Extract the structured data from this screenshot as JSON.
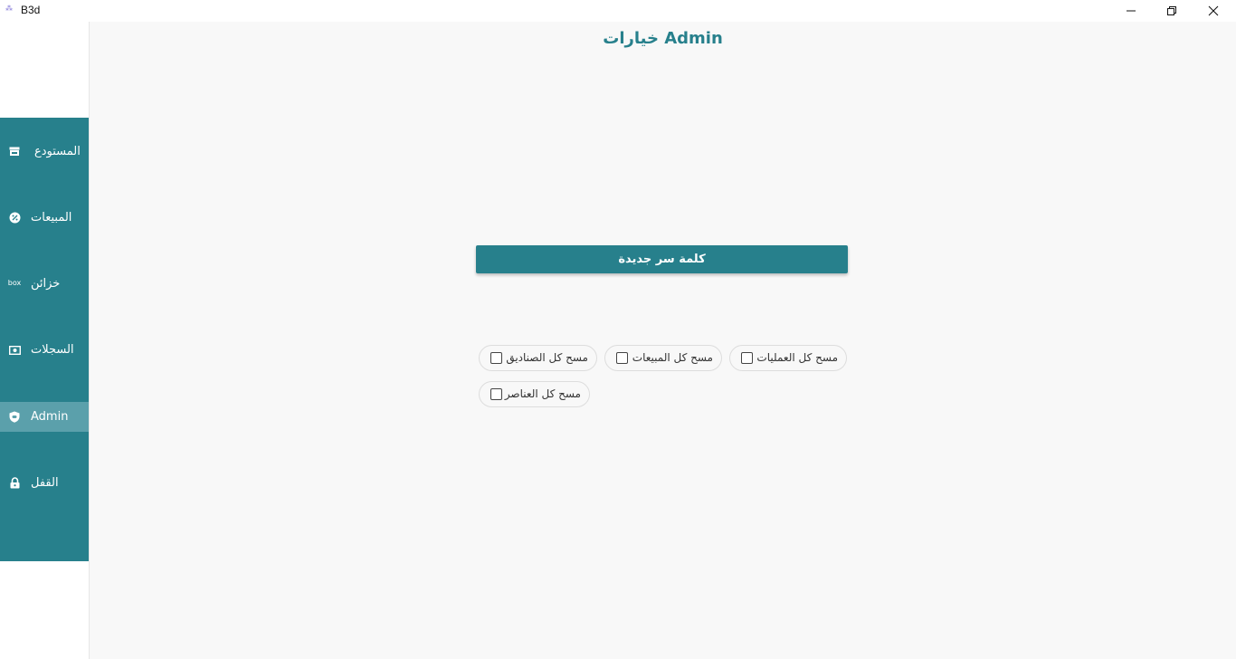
{
  "window": {
    "title": "B3d",
    "app_icon": "app-icon"
  },
  "sidebar": {
    "items": [
      {
        "label": "المستودع",
        "icon": "store-icon",
        "active": false
      },
      {
        "label": "المبيعات",
        "icon": "discount-badge-icon",
        "active": false
      },
      {
        "label": "خزائن",
        "icon": "box-icon",
        "icon_text": "box",
        "active": false
      },
      {
        "label": "السجلات",
        "icon": "cash-icon",
        "active": false
      },
      {
        "label": "Admin",
        "icon": "shield-icon",
        "active": true
      },
      {
        "label": "القفل",
        "icon": "lock-icon",
        "active": false
      }
    ]
  },
  "main": {
    "title": "خيارات Admin",
    "new_password_button": "كلمة سر جديدة",
    "options": [
      {
        "label": "مسح كل العمليات",
        "checked": false
      },
      {
        "label": "مسح كل المبيعات",
        "checked": false
      },
      {
        "label": "مسح كل الصناديق",
        "checked": false
      },
      {
        "label": "مسح كل العناصر",
        "checked": false
      }
    ]
  },
  "colors": {
    "accent": "#27808c",
    "active_item": "#5ba0ab",
    "background": "#f8f8f8"
  }
}
